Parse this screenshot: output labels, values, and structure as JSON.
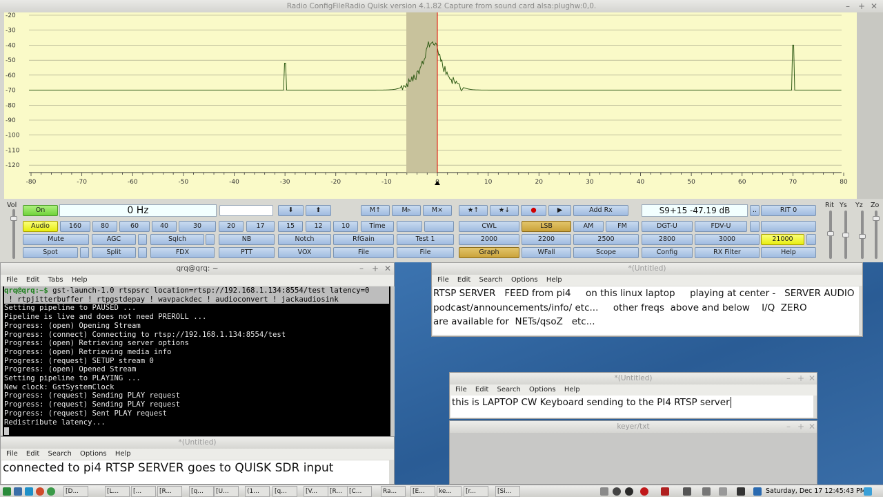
{
  "quisk": {
    "title": "Radio ConfigFileRadio   Quisk version 4.1.82   Capture from sound card alsa:plughw:0,0.",
    "window_buttons": [
      "–",
      "+",
      "✕"
    ],
    "y_ticks": [
      "-20",
      "-30",
      "-40",
      "-50",
      "-60",
      "-70",
      "-80",
      "-90",
      "-100",
      "-110",
      "-120"
    ],
    "x_ticks": [
      "-80",
      "-70",
      "-60",
      "-50",
      "-40",
      "-30",
      "-20",
      "-10",
      "0",
      "10",
      "20",
      "30",
      "40",
      "50",
      "60",
      "70",
      "80"
    ],
    "vol_label": "Vol",
    "slider_labels": [
      "Rit",
      "Ys",
      "Yz",
      "Zo"
    ],
    "freq_display": "0 Hz",
    "smeter": "S9+15   -47.19  dB",
    "buttons": {
      "on": "On",
      "audio": "Audio",
      "b160": "160",
      "b80": "80",
      "b60": "60",
      "b40": "40",
      "b30": "30",
      "b20": "20",
      "b17": "17",
      "b15": "15",
      "b12": "12",
      "b10": "10",
      "time": "Time",
      "mute": "Mute",
      "agc": "AGC",
      "sqlch": "Sqlch",
      "nb": "NB",
      "notch": "Notch",
      "rfgain": "RfGain",
      "test1": "Test 1",
      "spot": "Spot",
      "split": "Split",
      "fdx": "FDX",
      "ptt": "PTT",
      "vox": "VOX",
      "file1": "File",
      "file2": "File",
      "dn": "⬇",
      "up": "⬆",
      "m1": "M↑",
      "m2": "M▹",
      "m3": "M×",
      "star_up": "★↑",
      "star_dn": "★↓",
      "rec": "●",
      "play": "▶",
      "addrx": "Add Rx",
      "dots": "..",
      "rit": "RIT 0",
      "cwl": "CWL",
      "lsb": "LSB",
      "am": "AM",
      "fm": "FM",
      "dgtu": "DGT-U",
      "fdvu": "FDV-U",
      "f2000": "2000",
      "f2200": "2200",
      "f2500": "2500",
      "f2800": "2800",
      "f3000": "3000",
      "f21000": "21000",
      "graph": "Graph",
      "wfall": "WFall",
      "scope": "Scope",
      "config": "Config",
      "rxfilter": "RX Filter",
      "help": "Help"
    }
  },
  "terminal": {
    "title": "qrq@qrq: ~",
    "menu": [
      "File",
      "Edit",
      "Tabs",
      "Help"
    ],
    "prompt": "qrq@qrq:~$",
    "cmd1": " gst-launch-1.0 rtspsrc location=rtsp://192.168.1.134:8554/test latency=0",
    "cmd2": " ! rtpjitterbuffer ! rtpgstdepay ! wavpackdec ! audioconvert ! jackaudiosink",
    "output": [
      "Setting pipeline to PAUSED ...",
      "Pipeline is live and does not need PREROLL ...",
      "Progress: (open) Opening Stream",
      "Progress: (connect) Connecting to rtsp://192.168.1.134:8554/test",
      "Progress: (open) Retrieving server options",
      "Progress: (open) Retrieving media info",
      "Progress: (request) SETUP stream 0",
      "Progress: (open) Opened Stream",
      "Setting pipeline to PLAYING ...",
      "New clock: GstSystemClock",
      "Progress: (request) Sending PLAY request",
      "Progress: (request) Sending PLAY request",
      "Progress: (request) Sent PLAY request",
      "Redistribute latency..."
    ]
  },
  "editor_left": {
    "title": "*(Untitled)",
    "menu": [
      "File",
      "Edit",
      "Search",
      "Options",
      "Help"
    ],
    "text": "connected to pi4 RTSP SERVER    goes to QUISK SDR input"
  },
  "editor_top": {
    "title": "*(Untitled)",
    "menu": [
      "File",
      "Edit",
      "Search",
      "Options",
      "Help"
    ],
    "lines": [
      "RTSP SERVER   FEED from pi4     on this linux laptop     playing at center -   SERVER AUDIO",
      "podcast/announcements/info/ etc...     other freqs  above and below    I/Q  ZERO",
      "are available for  NETs/qsoZ   etc..."
    ]
  },
  "editor_mid": {
    "title": "*(Untitled)",
    "menu": [
      "File",
      "Edit",
      "Search",
      "Options",
      "Help"
    ],
    "text": "this is LAPTOP CW Keyboard sending to the PI4 RTSP server"
  },
  "keyer": {
    "title": "keyer/txt"
  },
  "taskbar": {
    "tasks": [
      "[D...",
      "[L...",
      "[...",
      "[R...",
      "[q...",
      "[U...",
      "(1...",
      "[q...",
      "[V...",
      "[R...",
      "[C...",
      "Ra...",
      "[E...",
      "ke...",
      "[r...",
      "[Si..."
    ],
    "clock": "Saturday, Dec 17 12:45:43 PM"
  },
  "colors": {
    "spectrum_bg": "#fafac8",
    "trace": "#2e5a14",
    "filter_band": "#c8c29c",
    "marker": "#e00000"
  }
}
